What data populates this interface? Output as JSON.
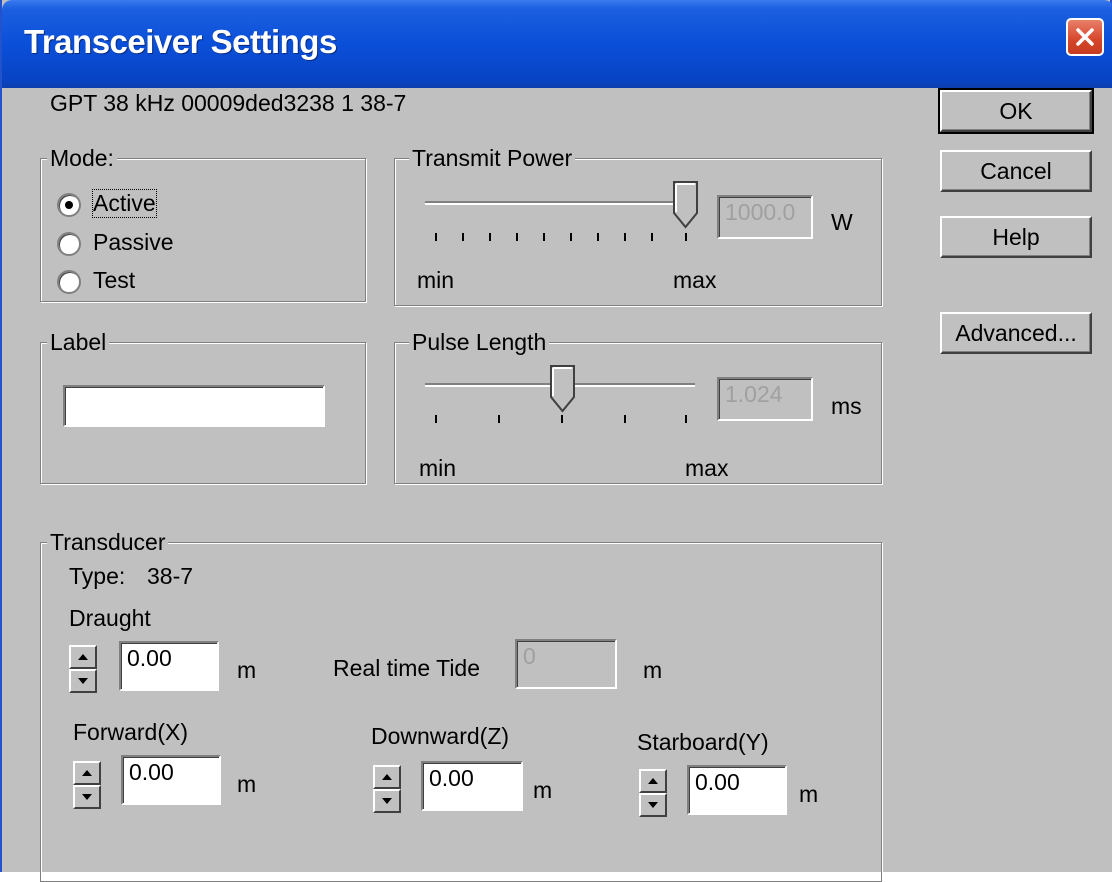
{
  "window": {
    "title": "Transceiver Settings"
  },
  "device_info": "GPT  38 kHz 00009ded3238 1 38-7",
  "buttons": {
    "ok": "OK",
    "cancel": "Cancel",
    "help": "Help",
    "advanced": "Advanced..."
  },
  "mode": {
    "legend": "Mode:",
    "options": [
      {
        "label": "Active",
        "selected": true
      },
      {
        "label": "Passive",
        "selected": false
      },
      {
        "label": "Test",
        "selected": false
      }
    ]
  },
  "transmit_power": {
    "legend": "Transmit Power",
    "value": "1000.0",
    "unit": "W",
    "min_label": "min",
    "max_label": "max",
    "level": 1.0
  },
  "label_group": {
    "legend": "Label",
    "value": ""
  },
  "pulse_length": {
    "legend": "Pulse Length",
    "value": "1.024",
    "unit": "ms",
    "min_label": "min",
    "max_label": "max",
    "level": 0.5
  },
  "transducer": {
    "legend": "Transducer",
    "type_label": "Type:",
    "type_value": "38-7",
    "draught": {
      "label": "Draught",
      "value": "0.00",
      "unit": "m"
    },
    "real_time_tide": {
      "label": "Real time Tide",
      "value": "0",
      "unit": "m"
    },
    "forward": {
      "label": "Forward(X)",
      "value": "0.00",
      "unit": "m"
    },
    "downward": {
      "label": "Downward(Z)",
      "value": "0.00",
      "unit": "m"
    },
    "starboard": {
      "label": "Starboard(Y)",
      "value": "0.00",
      "unit": "m"
    }
  },
  "colors": {
    "title_bar": "#0a4fd9",
    "close_button": "#d5452a",
    "dialog_bg": "#c0c0c0"
  }
}
